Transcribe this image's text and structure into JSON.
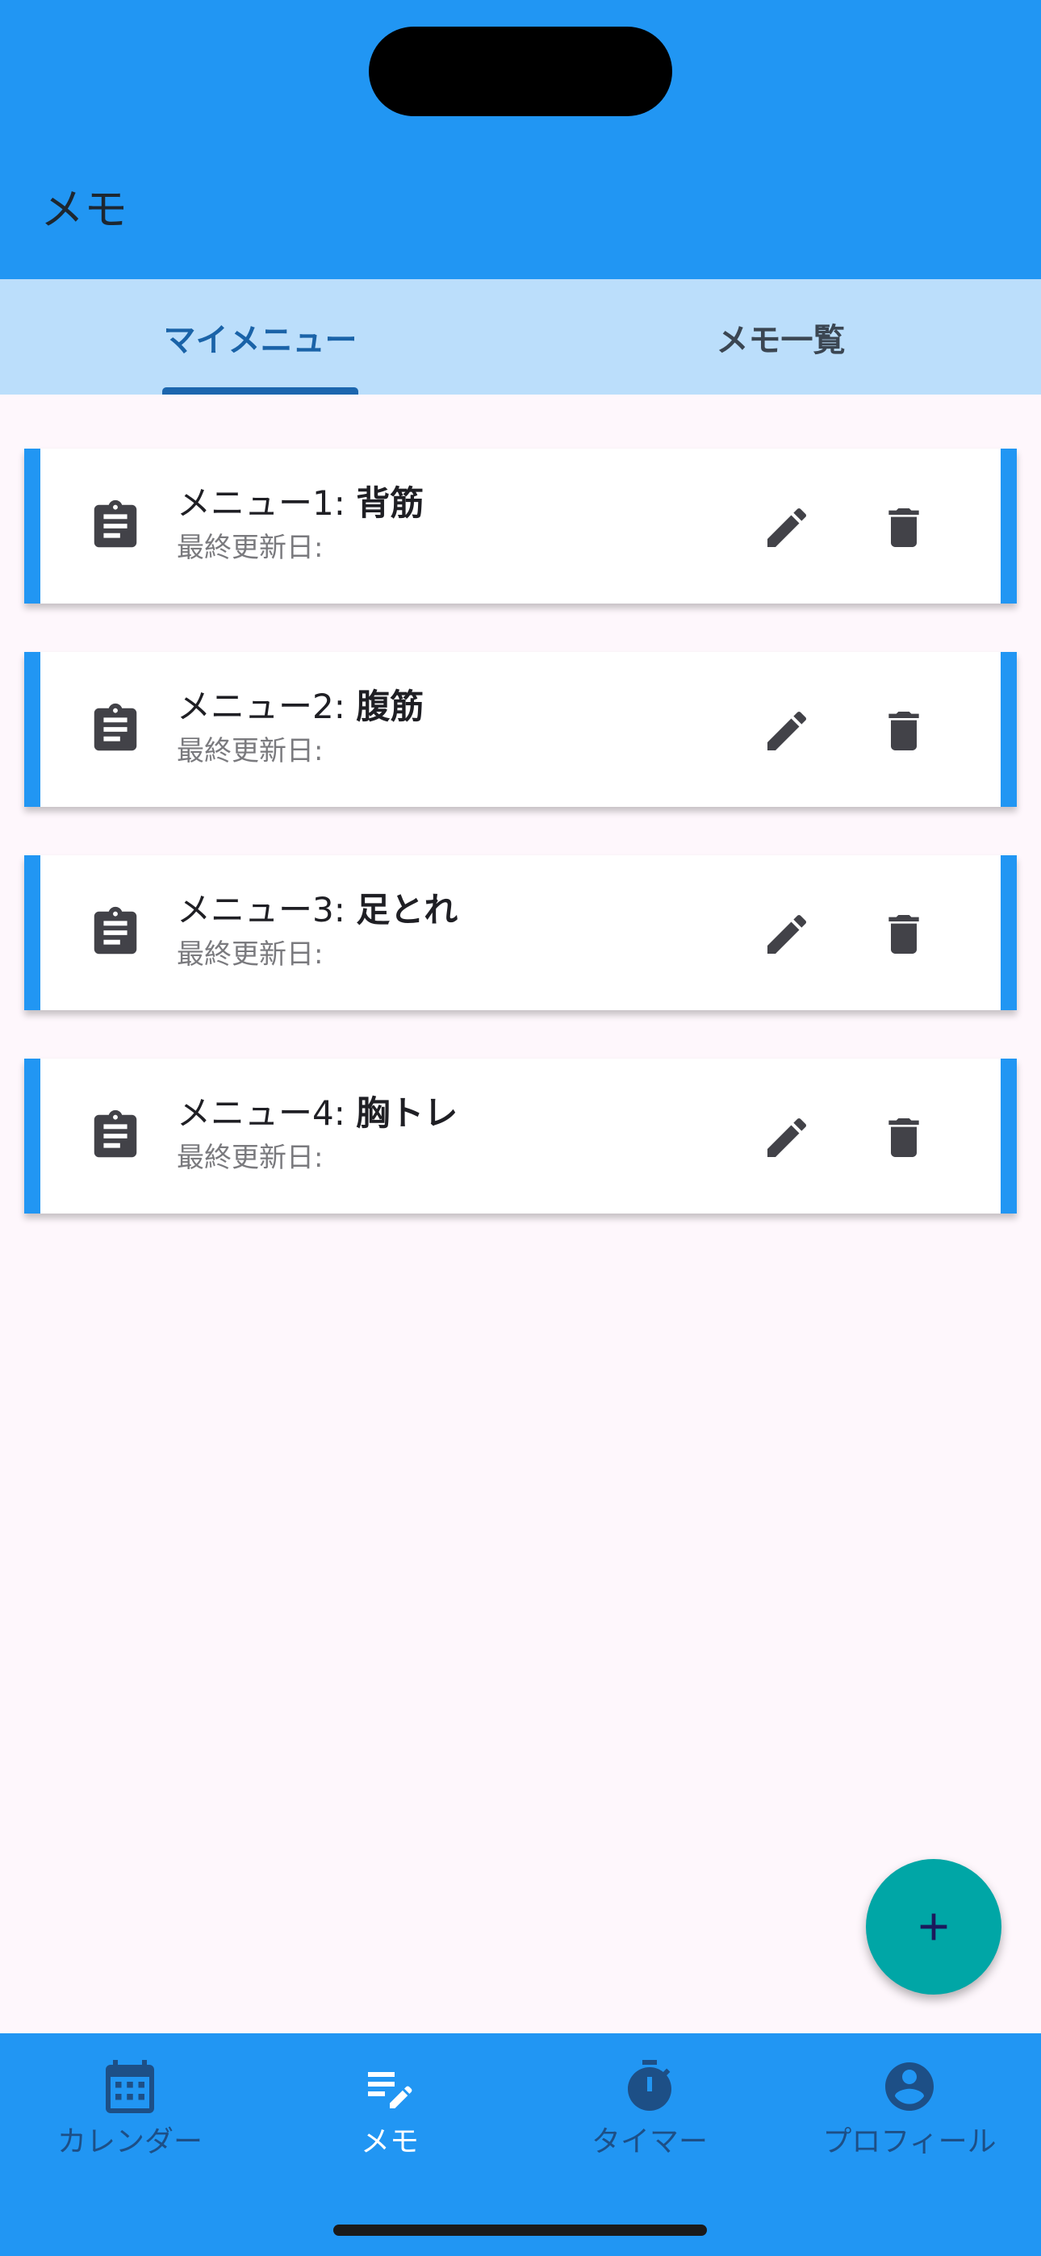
{
  "app_bar": {
    "title": "メモ"
  },
  "tabs": [
    {
      "label": "マイメニュー",
      "selected": true
    },
    {
      "label": "メモ一覧",
      "selected": false
    }
  ],
  "menus": [
    {
      "prefix": "メニュー1: ",
      "name": "背筋",
      "updated_label": "最終更新日:"
    },
    {
      "prefix": "メニュー2: ",
      "name": "腹筋",
      "updated_label": "最終更新日:"
    },
    {
      "prefix": "メニュー3: ",
      "name": "足とれ",
      "updated_label": "最終更新日:"
    },
    {
      "prefix": "メニュー4: ",
      "name": "胸トレ",
      "updated_label": "最終更新日:"
    }
  ],
  "fab": {
    "icon": "plus-icon"
  },
  "bottom_nav": [
    {
      "label": "カレンダー",
      "icon": "calendar-icon",
      "active": false
    },
    {
      "label": "メモ",
      "icon": "note-edit-icon",
      "active": true
    },
    {
      "label": "タイマー",
      "icon": "timer-icon",
      "active": false
    },
    {
      "label": "プロフィール",
      "icon": "profile-icon",
      "active": false
    }
  ],
  "colors": {
    "primary": "#2196f3",
    "tab_bar": "#bbdefb",
    "selected_tab": "#1a63a8",
    "fab": "#00a6a6",
    "icon_dark": "#424248"
  }
}
